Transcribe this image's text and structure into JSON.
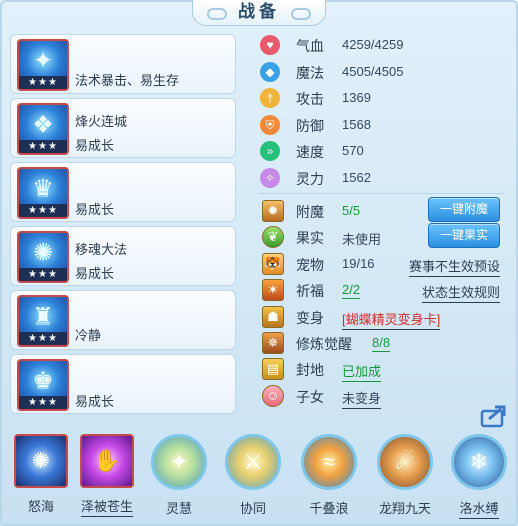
{
  "title": "战备",
  "cards": [
    {
      "icon": "flame-orb-icon",
      "name": "",
      "sub": "法术暴击、易生存",
      "stars": "★★★"
    },
    {
      "icon": "phoenix-icon",
      "name": "烽火连城",
      "sub": "易成长",
      "stars": "★★★"
    },
    {
      "icon": "crowned-bust-icon",
      "name": "",
      "sub": "易成长",
      "stars": "★★★"
    },
    {
      "icon": "swirl-crown-icon",
      "name": "移魂大法",
      "sub": "易成长",
      "stars": "★★★"
    },
    {
      "icon": "crown-water-icon",
      "name": "冷静",
      "sub": "",
      "stars": "★★★"
    },
    {
      "icon": "crown-pillar-icon",
      "name": "",
      "sub": "易成长",
      "stars": "★★★"
    }
  ],
  "stats": [
    {
      "key": "hp",
      "label": "气血",
      "value": "4259/4259",
      "color": "#e85a6a",
      "icon": "heart-icon"
    },
    {
      "key": "mp",
      "label": "魔法",
      "value": "4505/4505",
      "color": "#3aa0e8",
      "icon": "diamond-icon"
    },
    {
      "key": "atk",
      "label": "攻击",
      "value": "1369",
      "color": "#f0b43a",
      "icon": "sword-icon"
    },
    {
      "key": "def",
      "label": "防御",
      "value": "1568",
      "color": "#f08a3a",
      "icon": "shield-icon"
    },
    {
      "key": "spd",
      "label": "速度",
      "value": "570",
      "color": "#26c07a",
      "icon": "speed-icon"
    },
    {
      "key": "spi",
      "label": "灵力",
      "value": "1562",
      "color": "#c88ae8",
      "icon": "sparkle-icon"
    }
  ],
  "props": {
    "fumo": {
      "label": "附魔",
      "value": "5/5",
      "button": "一键附魔",
      "icon": "enchant-icon"
    },
    "guoshi": {
      "label": "果实",
      "value": "未使用",
      "button": "一键果实",
      "icon": "leaf-icon"
    },
    "pet": {
      "label": "宠物",
      "value": "19/16",
      "right": "赛事不生效预设",
      "icon": "tiger-icon"
    },
    "qifu": {
      "label": "祈福",
      "value": "2/2",
      "right": "状态生效规则",
      "icon": "prayer-icon"
    },
    "bianshen": {
      "label": "变身",
      "value": "[蝴蝶精灵变身卡]",
      "icon": "transform-icon"
    },
    "xiulian": {
      "label": "修炼觉醒",
      "value": "8/8",
      "icon": "training-icon"
    },
    "fengdi": {
      "label": "封地",
      "value": "已加成",
      "icon": "fief-icon"
    },
    "zinv": {
      "label": "子女",
      "value": "未变身",
      "icon": "child-icon"
    }
  },
  "skills": [
    {
      "name": "怒海",
      "icon": "angry-sea-icon",
      "style": "square",
      "underline": false
    },
    {
      "name": "泽被苍生",
      "icon": "blessing-hand-icon",
      "style": "square",
      "underline": true
    },
    {
      "name": "灵慧",
      "icon": "wisdom-figure-icon",
      "style": "round",
      "underline": false
    },
    {
      "name": "协同",
      "icon": "sword-rays-icon",
      "style": "round",
      "underline": false
    },
    {
      "name": "千叠浪",
      "icon": "wave-orb-icon",
      "style": "round",
      "underline": false
    },
    {
      "name": "龙翔九天",
      "icon": "dragon-sky-icon",
      "style": "round",
      "underline": false
    },
    {
      "name": "洛水缚",
      "icon": "water-bind-icon",
      "style": "round",
      "underline": true
    }
  ]
}
